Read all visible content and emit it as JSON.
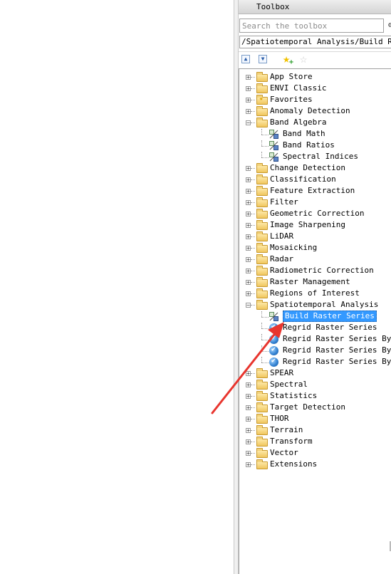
{
  "toolbox": {
    "title": "Toolbox",
    "search_placeholder": "Search the toolbox",
    "path": "/Spatiotemporal Analysis/Build Rast",
    "toolbar": {
      "up_icon": "arrow-up",
      "down_icon": "arrow-down",
      "add_favorite_icon": "star-plus",
      "remove_favorite_icon": "star-outline"
    }
  },
  "tree": [
    {
      "label": "App Store",
      "type": "folder",
      "expanded": false
    },
    {
      "label": "ENVI Classic",
      "type": "folder",
      "expanded": false
    },
    {
      "label": "Favorites",
      "type": "folder-favorites",
      "expanded": false
    },
    {
      "label": "Anomaly Detection",
      "type": "folder",
      "expanded": false
    },
    {
      "label": "Band Algebra",
      "type": "folder",
      "expanded": true
    },
    {
      "label": "Band Math",
      "type": "tool",
      "indent": 1
    },
    {
      "label": "Band Ratios",
      "type": "tool",
      "indent": 1
    },
    {
      "label": "Spectral Indices",
      "type": "tool",
      "indent": 1
    },
    {
      "label": "Change Detection",
      "type": "folder",
      "expanded": false
    },
    {
      "label": "Classification",
      "type": "folder",
      "expanded": false
    },
    {
      "label": "Feature Extraction",
      "type": "folder",
      "expanded": false
    },
    {
      "label": "Filter",
      "type": "folder",
      "expanded": false
    },
    {
      "label": "Geometric Correction",
      "type": "folder",
      "expanded": false
    },
    {
      "label": "Image Sharpening",
      "type": "folder",
      "expanded": false
    },
    {
      "label": "LiDAR",
      "type": "folder",
      "expanded": false
    },
    {
      "label": "Mosaicking",
      "type": "folder",
      "expanded": false
    },
    {
      "label": "Radar",
      "type": "folder",
      "expanded": false
    },
    {
      "label": "Radiometric Correction",
      "type": "folder",
      "expanded": false
    },
    {
      "label": "Raster Management",
      "type": "folder",
      "expanded": false
    },
    {
      "label": "Regions of Interest",
      "type": "folder",
      "expanded": false
    },
    {
      "label": "Spatiotemporal Analysis",
      "type": "folder",
      "expanded": true
    },
    {
      "label": "Build Raster Series",
      "type": "tool",
      "indent": 1,
      "selected": true
    },
    {
      "label": "Regrid Raster Series",
      "type": "globe-tool",
      "indent": 1
    },
    {
      "label": "Regrid Raster Series By I",
      "type": "globe-tool",
      "indent": 1
    },
    {
      "label": "Regrid Raster Series By I",
      "type": "globe-tool",
      "indent": 1
    },
    {
      "label": "Regrid Raster Series By U",
      "type": "globe-tool",
      "indent": 1
    },
    {
      "label": "SPEAR",
      "type": "folder",
      "expanded": false
    },
    {
      "label": "Spectral",
      "type": "folder",
      "expanded": false
    },
    {
      "label": "Statistics",
      "type": "folder",
      "expanded": false
    },
    {
      "label": "Target Detection",
      "type": "folder",
      "expanded": false
    },
    {
      "label": "THOR",
      "type": "folder",
      "expanded": false
    },
    {
      "label": "Terrain",
      "type": "folder",
      "expanded": false
    },
    {
      "label": "Transform",
      "type": "folder",
      "expanded": false
    },
    {
      "label": "Vector",
      "type": "folder",
      "expanded": false
    },
    {
      "label": "Extensions",
      "type": "folder",
      "expanded": false
    }
  ],
  "colors": {
    "selection_bg": "#3399ff",
    "annotation_arrow": "#e8352e"
  }
}
